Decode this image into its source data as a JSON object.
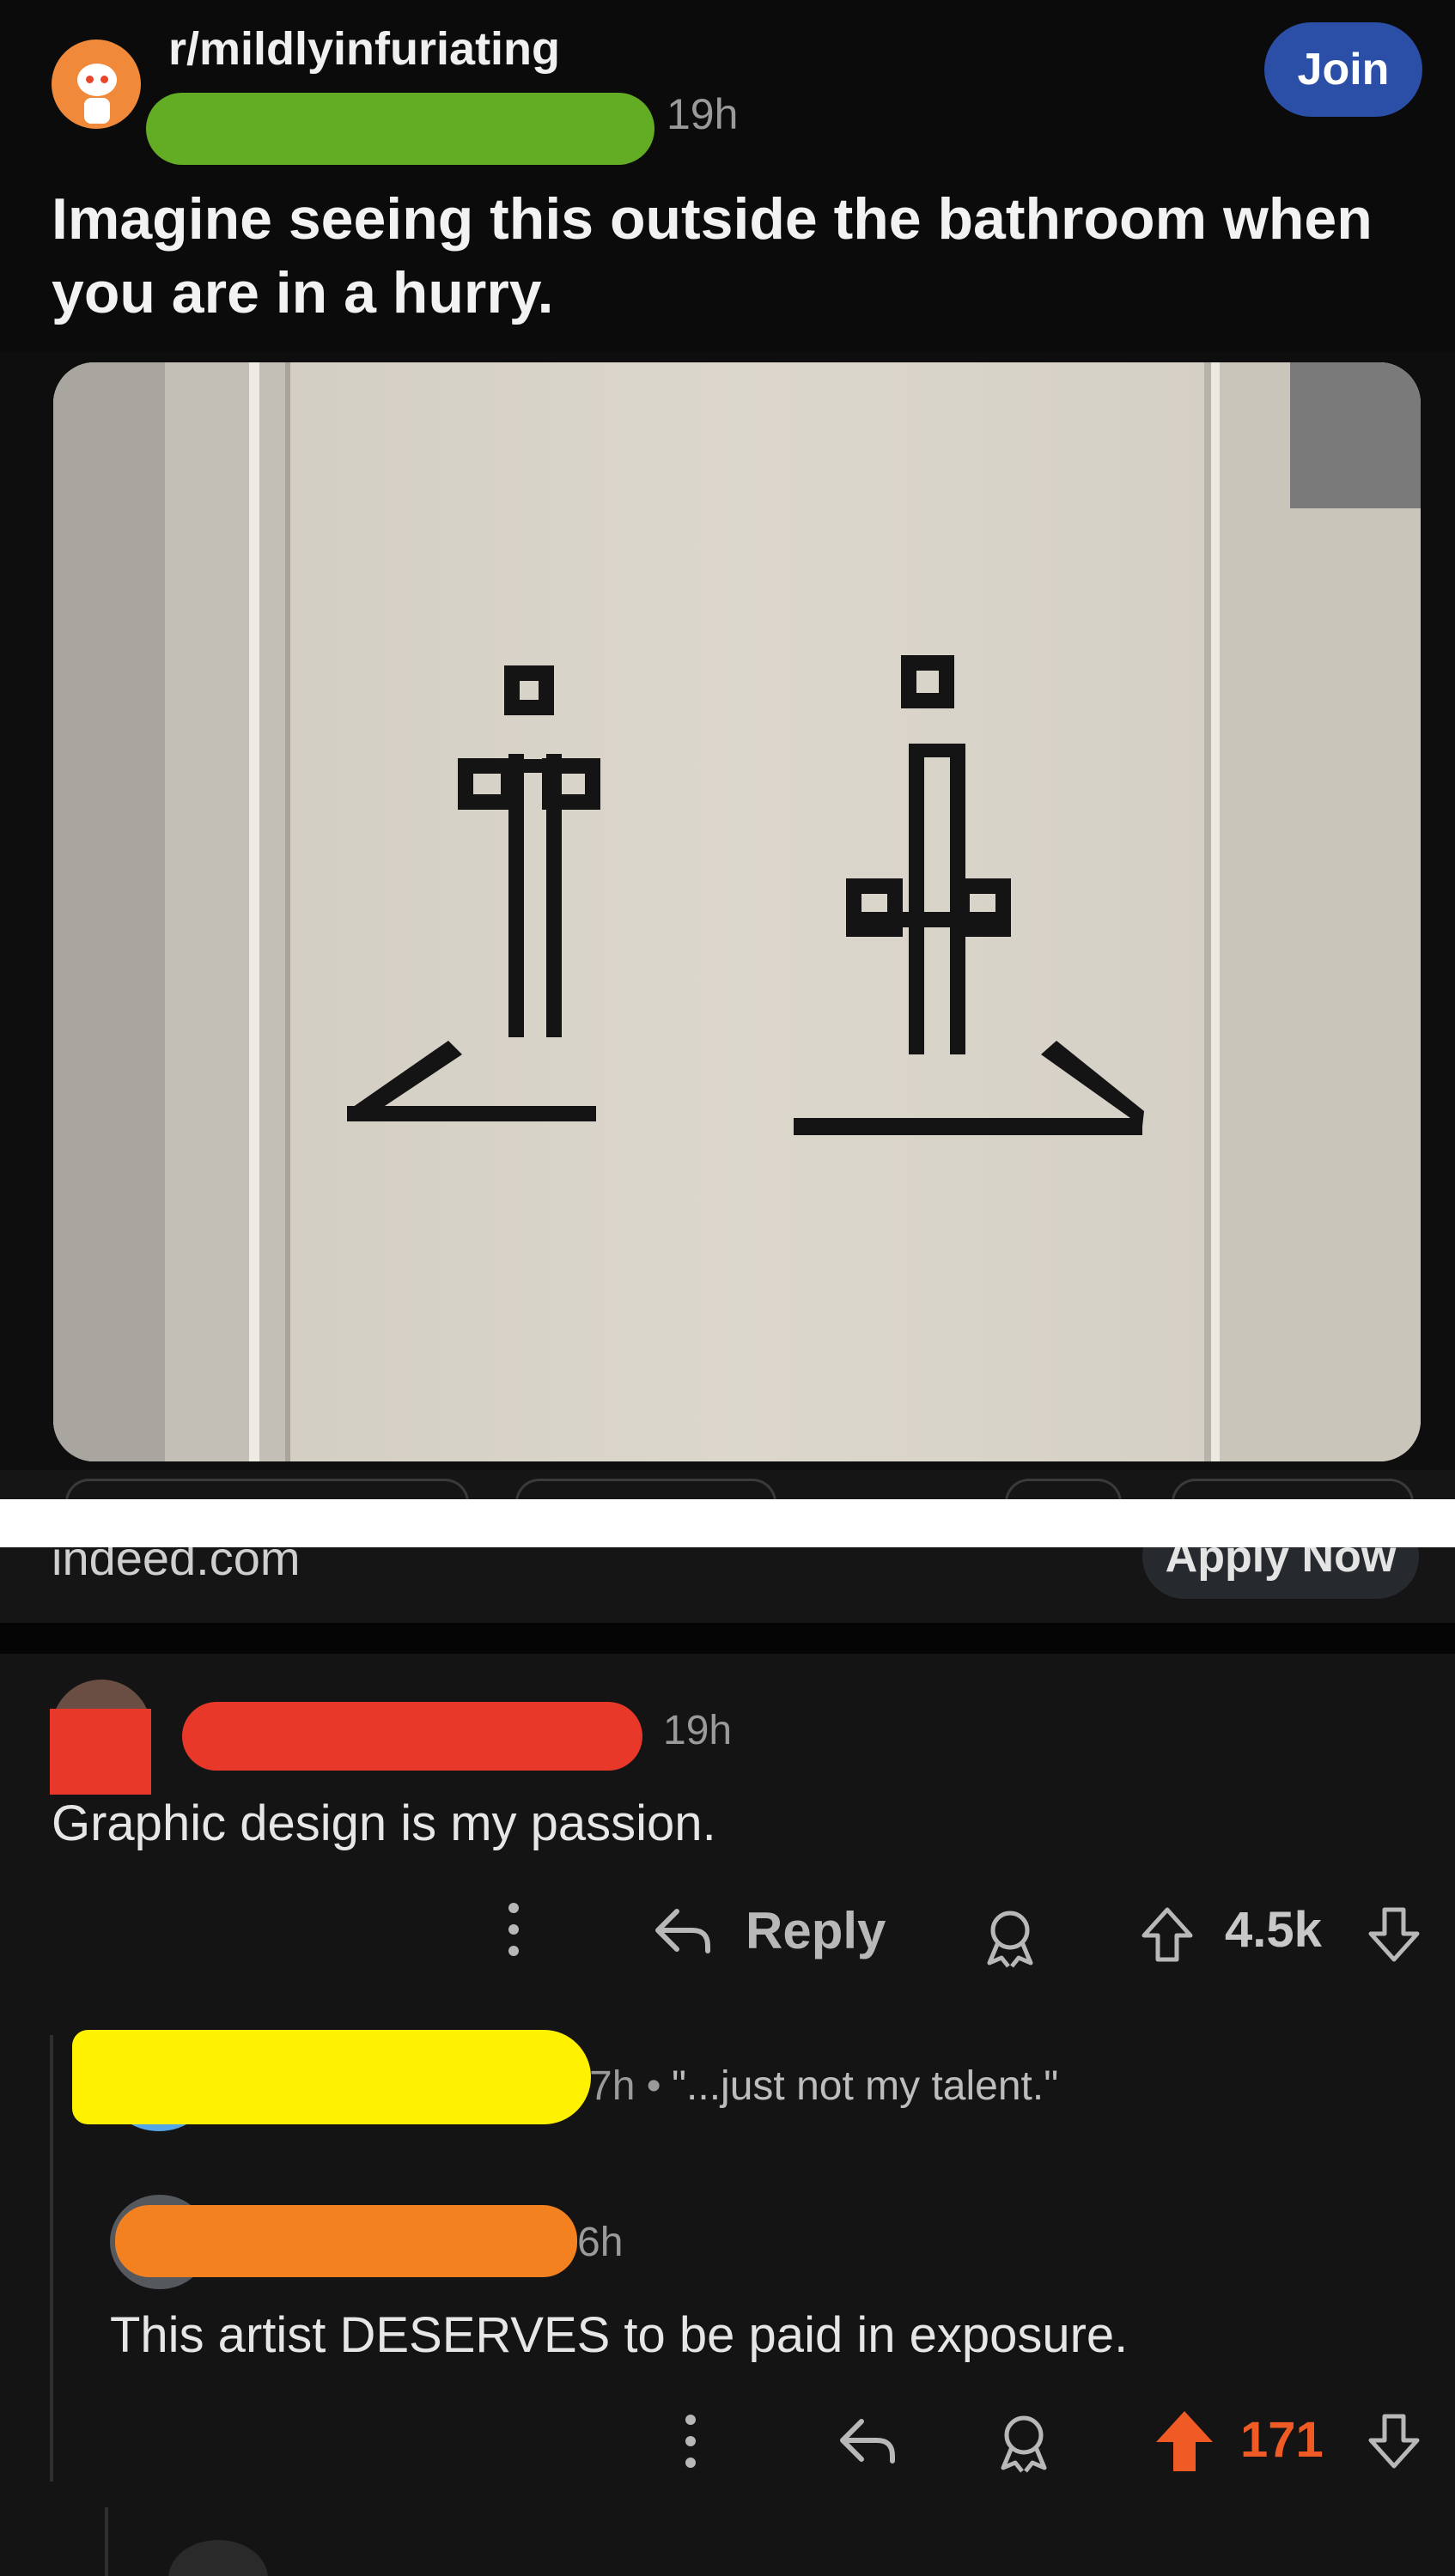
{
  "post": {
    "subreddit": "r/mildlyinfuriating",
    "time": "19h",
    "join_label": "Join",
    "title": "Imagine seeing this outside the bathroom when you are in a hurry."
  },
  "ad": {
    "domain": "indeed.com",
    "cta_label": "Apply Now"
  },
  "comments": [
    {
      "time": "19h",
      "text": "Graphic design is my passion.",
      "reply_label": "Reply",
      "score": "4.5k"
    },
    {
      "meta": "7h •",
      "quote": "\"...just not my talent.\""
    },
    {
      "time": "6h",
      "text": "This artist DESERVES to be paid in exposure.",
      "score": "171",
      "upvoted": true
    }
  ],
  "colors": {
    "join": "#2b4fa7",
    "upvote_active": "#f05a24",
    "subreddit_avatar": "#f08a3a"
  },
  "icons": [
    "more-icon",
    "reply-icon",
    "award-icon",
    "upvote-icon",
    "downvote-icon"
  ]
}
